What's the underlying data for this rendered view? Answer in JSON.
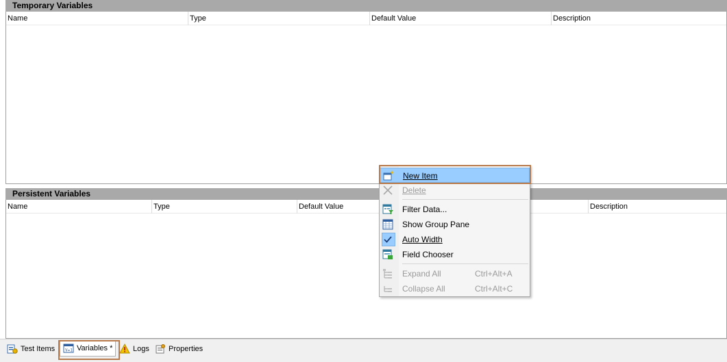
{
  "temporary": {
    "title": "Temporary Variables",
    "columns": [
      "Name",
      "Type",
      "Default Value",
      "Description"
    ]
  },
  "persistent": {
    "title": "Persistent Variables",
    "columns": [
      "Name",
      "Type",
      "Default Value",
      "Description"
    ]
  },
  "context_menu": {
    "items": [
      {
        "label": "New Item",
        "icon": "new-item-icon",
        "state": "highlighted"
      },
      {
        "label": "Delete",
        "icon": "delete-icon",
        "state": "disabled"
      },
      {
        "label": "Filter Data...",
        "icon": "filter-icon"
      },
      {
        "label": "Show Group Pane",
        "icon": "group-pane-icon"
      },
      {
        "label": "Auto Width",
        "icon": "checkmark-icon",
        "state": "checked"
      },
      {
        "label": "Field Chooser",
        "icon": "field-chooser-icon"
      },
      {
        "label": "Expand All",
        "shortcut": "Ctrl+Alt+A",
        "icon": "expand-all-icon",
        "state": "disabled"
      },
      {
        "label": "Collapse All",
        "shortcut": "Ctrl+Alt+C",
        "icon": "collapse-all-icon",
        "state": "disabled"
      }
    ]
  },
  "tabs": [
    {
      "label": "Test Items",
      "icon": "test-items-icon"
    },
    {
      "label": "Variables *",
      "icon": "variables-icon",
      "active": true
    },
    {
      "label": "Logs",
      "icon": "logs-icon"
    },
    {
      "label": "Properties",
      "icon": "properties-icon"
    }
  ],
  "colors": {
    "header_bg": "#a9a9a9",
    "menu_highlight": "#99ccff",
    "annotation_border": "#b87a4b"
  }
}
